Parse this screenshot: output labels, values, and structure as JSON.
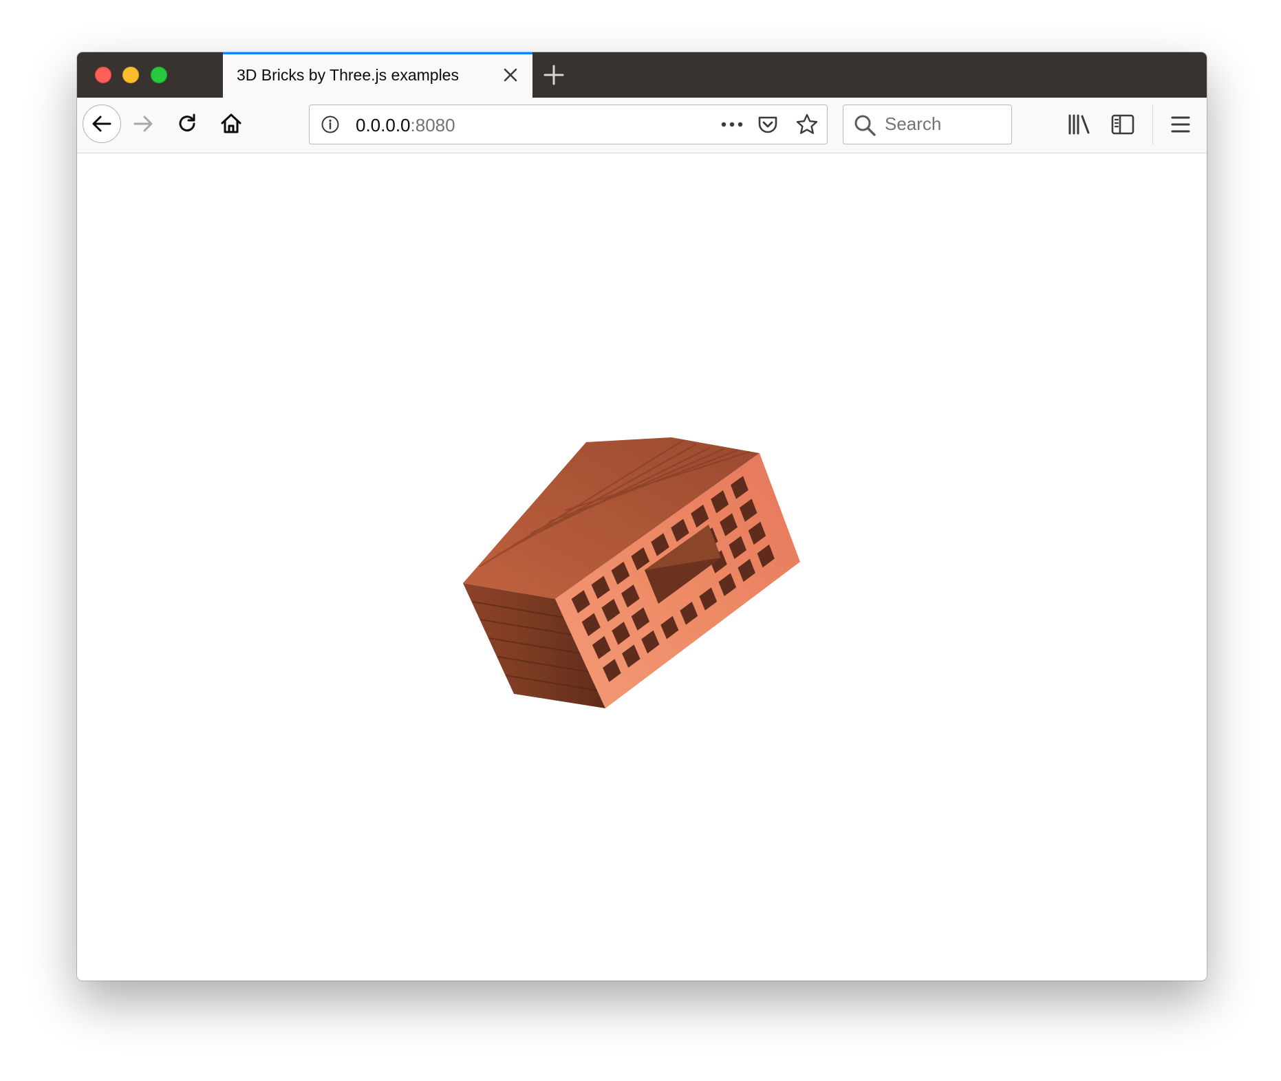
{
  "window": {
    "controls": [
      "close",
      "minimize",
      "zoom"
    ],
    "colors": {
      "close": "#fe5f57",
      "minimize": "#febc2e",
      "zoom": "#28c840",
      "tabbar": "#38332f",
      "tab_accent": "#0a84ff"
    }
  },
  "tab": {
    "title": "3D Bricks by Three.js examples",
    "close_icon": "close-icon"
  },
  "new_tab_icon": "plus-icon",
  "toolbar": {
    "back_icon": "arrow-left-icon",
    "forward_icon": "arrow-right-icon",
    "reload_icon": "reload-icon",
    "home_icon": "home-icon"
  },
  "urlbar": {
    "host": "0.0.0.0",
    "port": ":8080",
    "info_icon": "info-icon",
    "more_icon": "ellipsis-icon",
    "pocket_icon": "pocket-icon",
    "bookmark_icon": "star-icon"
  },
  "search": {
    "placeholder": "Search",
    "icon": "search-icon"
  },
  "toolbar_right": {
    "library_icon": "library-icon",
    "sidebar_icon": "sidebar-icon",
    "menu_icon": "hamburger-menu-icon"
  },
  "content": {
    "scene": "3d-hollow-clay-brick",
    "brick_colors": {
      "face": "#f08a66",
      "side": "#7a3a22",
      "top": "#a8543a",
      "hole": "#5e2c1c"
    }
  }
}
